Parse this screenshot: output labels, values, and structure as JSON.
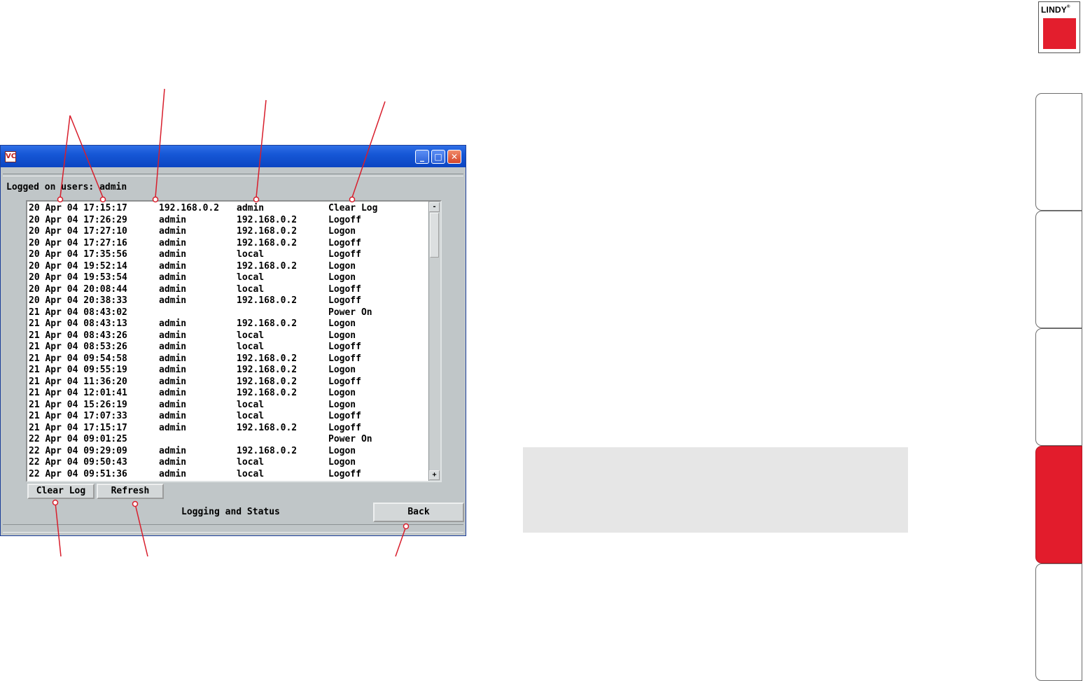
{
  "window": {
    "title_icon": "VC",
    "buttons": {
      "minimize": "_",
      "maximize": "□",
      "close": "✕"
    },
    "logged_on_label": "Logged on users:",
    "logged_on_value": "admin",
    "log_rows": [
      [
        "20 Apr 04 17:15:17",
        "192.168.0.2",
        "admin",
        "Clear Log"
      ],
      [
        "20 Apr 04 17:26:29",
        "admin",
        "192.168.0.2",
        "Logoff"
      ],
      [
        "20 Apr 04 17:27:10",
        "admin",
        "192.168.0.2",
        "Logon"
      ],
      [
        "20 Apr 04 17:27:16",
        "admin",
        "192.168.0.2",
        "Logoff"
      ],
      [
        "20 Apr 04 17:35:56",
        "admin",
        "local",
        "Logoff"
      ],
      [
        "20 Apr 04 19:52:14",
        "admin",
        "192.168.0.2",
        "Logon"
      ],
      [
        "20 Apr 04 19:53:54",
        "admin",
        "local",
        "Logon"
      ],
      [
        "20 Apr 04 20:08:44",
        "admin",
        "local",
        "Logoff"
      ],
      [
        "20 Apr 04 20:38:33",
        "admin",
        "192.168.0.2",
        "Logoff"
      ],
      [
        "21 Apr 04 08:43:02",
        "",
        "",
        "Power On"
      ],
      [
        "21 Apr 04 08:43:13",
        "admin",
        "192.168.0.2",
        "Logon"
      ],
      [
        "21 Apr 04 08:43:26",
        "admin",
        "local",
        "Logon"
      ],
      [
        "21 Apr 04 08:53:26",
        "admin",
        "local",
        "Logoff"
      ],
      [
        "21 Apr 04 09:54:58",
        "admin",
        "192.168.0.2",
        "Logoff"
      ],
      [
        "21 Apr 04 09:55:19",
        "admin",
        "192.168.0.2",
        "Logon"
      ],
      [
        "21 Apr 04 11:36:20",
        "admin",
        "192.168.0.2",
        "Logoff"
      ],
      [
        "21 Apr 04 12:01:41",
        "admin",
        "192.168.0.2",
        "Logon"
      ],
      [
        "21 Apr 04 15:26:19",
        "admin",
        "local",
        "Logon"
      ],
      [
        "21 Apr 04 17:07:33",
        "admin",
        "local",
        "Logoff"
      ],
      [
        "21 Apr 04 17:15:17",
        "admin",
        "192.168.0.2",
        "Logoff"
      ],
      [
        "22 Apr 04 09:01:25",
        "",
        "",
        "Power On"
      ],
      [
        "22 Apr 04 09:29:09",
        "admin",
        "192.168.0.2",
        "Logon"
      ],
      [
        "22 Apr 04 09:50:43",
        "admin",
        "local",
        "Logon"
      ],
      [
        "22 Apr 04 09:51:36",
        "admin",
        "local",
        "Logoff"
      ]
    ],
    "scroll_up": "-",
    "scroll_down": "+",
    "clear_log_label": "Clear Log",
    "refresh_label": "Refresh",
    "screen_title": "Logging and Status",
    "back_label": "Back"
  },
  "logo": {
    "text": "LINDY",
    "registered": "®"
  },
  "colors": {
    "accent_red": "#e21c2c",
    "titlebar_blue": "#1657d6",
    "window_grey": "#c0c6c8",
    "callout_red": "#d81e2c"
  }
}
